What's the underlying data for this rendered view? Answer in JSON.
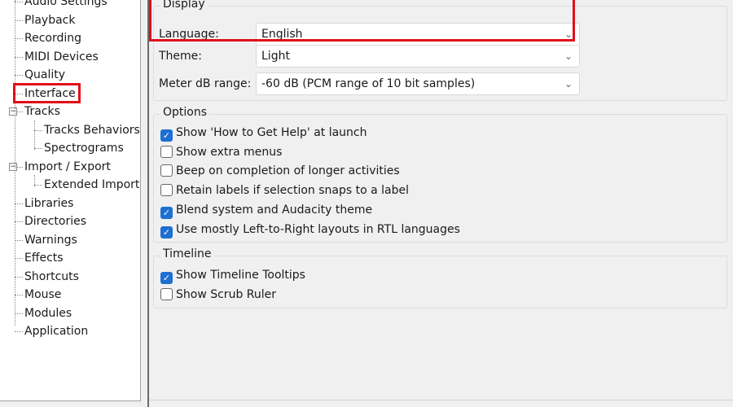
{
  "tree": {
    "items": [
      {
        "label": "Audio Settings",
        "level": 1
      },
      {
        "label": "Playback",
        "level": 1
      },
      {
        "label": "Recording",
        "level": 1
      },
      {
        "label": "MIDI Devices",
        "level": 1
      },
      {
        "label": "Quality",
        "level": 1
      },
      {
        "label": "Interface",
        "level": 1,
        "selected": true
      },
      {
        "label": "Tracks",
        "level": 1,
        "expander": "minus"
      },
      {
        "label": "Tracks Behaviors",
        "level": 2
      },
      {
        "label": "Spectrograms",
        "level": 2
      },
      {
        "label": "Import / Export",
        "level": 1,
        "expander": "minus"
      },
      {
        "label": "Extended Import",
        "level": 2
      },
      {
        "label": "Libraries",
        "level": 1
      },
      {
        "label": "Directories",
        "level": 1
      },
      {
        "label": "Warnings",
        "level": 1
      },
      {
        "label": "Effects",
        "level": 1
      },
      {
        "label": "Shortcuts",
        "level": 1
      },
      {
        "label": "Mouse",
        "level": 1
      },
      {
        "label": "Modules",
        "level": 1
      },
      {
        "label": "Application",
        "level": 1
      }
    ]
  },
  "display": {
    "title": "Display",
    "language": {
      "label": "Language:",
      "value": "English"
    },
    "theme": {
      "label": "Theme:",
      "value": "Light"
    },
    "meter": {
      "label": "Meter dB range:",
      "value": "-60 dB (PCM range of 10 bit samples)"
    }
  },
  "options": {
    "title": "Options",
    "items": [
      {
        "label": "Show 'How to Get Help' at launch",
        "checked": true
      },
      {
        "label": "Show extra menus",
        "checked": false
      },
      {
        "label": "Beep on completion of longer activities",
        "checked": false
      },
      {
        "label": "Retain labels if selection snaps to a label",
        "checked": false
      },
      {
        "label": "Blend system and Audacity theme",
        "checked": true
      },
      {
        "label": "Use mostly Left-to-Right layouts in RTL languages",
        "checked": true
      }
    ]
  },
  "timeline": {
    "title": "Timeline",
    "items": [
      {
        "label": "Show Timeline Tooltips",
        "checked": true
      },
      {
        "label": "Show Scrub Ruler",
        "checked": false
      }
    ]
  },
  "colors": {
    "highlight": "#e0101a",
    "checkbox": "#1d6fd1"
  },
  "icons": {
    "dropdown": "chevron-down-icon",
    "expander": "minus-box-icon",
    "check": "checkmark-icon"
  }
}
